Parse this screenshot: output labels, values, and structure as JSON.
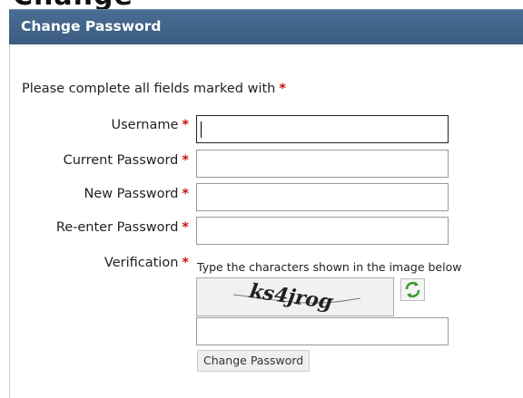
{
  "window": {
    "top_partial_text": "Change"
  },
  "header": {
    "title": "Change Password"
  },
  "form": {
    "intro": "Please complete all fields marked with",
    "required_marker": "*",
    "fields": [
      {
        "label": "Username",
        "value": ""
      },
      {
        "label": "Current Password",
        "value": ""
      },
      {
        "label": "New Password",
        "value": ""
      },
      {
        "label": "Re-enter Password",
        "value": ""
      }
    ],
    "verification": {
      "label": "Verification",
      "hint": "Type the characters shown in the image below",
      "captcha_text": "ks4jrog",
      "refresh_icon": "refresh-icon",
      "value": ""
    },
    "submit_label": "Change Password"
  },
  "colors": {
    "header_bg": "#3f6187",
    "required": "#cc1111"
  }
}
